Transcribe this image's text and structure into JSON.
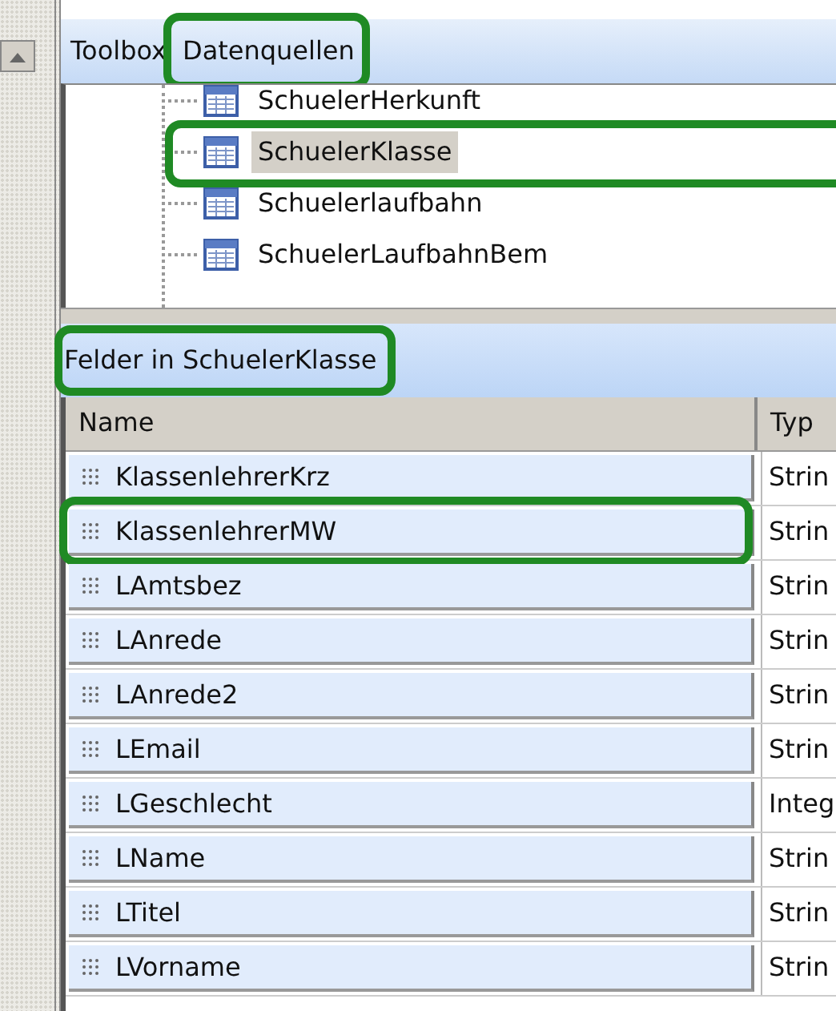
{
  "tabs": [
    {
      "label": "Toolbox",
      "highlighted": false
    },
    {
      "label": "Datenquellen",
      "highlighted": true
    }
  ],
  "tree": {
    "items": [
      {
        "label": "SchuelerHerkunft",
        "selected": false,
        "highlighted": false
      },
      {
        "label": "SchuelerKlasse",
        "selected": true,
        "highlighted": true
      },
      {
        "label": "Schuelerlaufbahn",
        "selected": false,
        "highlighted": false
      },
      {
        "label": "SchuelerLaufbahnBem",
        "selected": false,
        "highlighted": false
      }
    ]
  },
  "fields_panel": {
    "title": "Felder in SchuelerKlasse",
    "highlighted": true,
    "columns": [
      "Name",
      "Typ"
    ],
    "rows": [
      {
        "name": "KlassenlehrerKrz",
        "type": "Strin",
        "highlighted": false
      },
      {
        "name": "KlassenlehrerMW",
        "type": "Strin",
        "highlighted": true
      },
      {
        "name": "LAmtsbez",
        "type": "Strin",
        "highlighted": false
      },
      {
        "name": "LAnrede",
        "type": "Strin",
        "highlighted": false
      },
      {
        "name": "LAnrede2",
        "type": "Strin",
        "highlighted": false
      },
      {
        "name": "LEmail",
        "type": "Strin",
        "highlighted": false
      },
      {
        "name": "LGeschlecht",
        "type": "Integ",
        "highlighted": false
      },
      {
        "name": "LName",
        "type": "Strin",
        "highlighted": false
      },
      {
        "name": "LTitel",
        "type": "Strin",
        "highlighted": false
      },
      {
        "name": "LVorname",
        "type": "Strin",
        "highlighted": false
      }
    ]
  }
}
